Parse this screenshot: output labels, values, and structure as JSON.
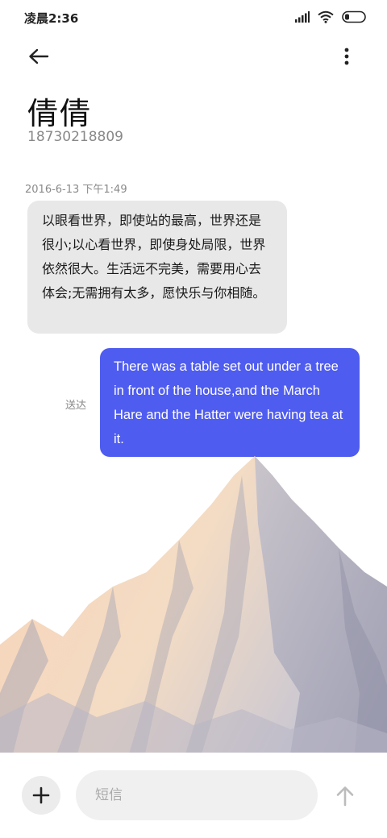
{
  "status_bar": {
    "time": "凌晨2:36"
  },
  "header": {
    "back_icon": "arrow-left-icon",
    "more_icon": "more-vertical-icon"
  },
  "contact": {
    "name": "倩倩",
    "number": "18730218809"
  },
  "messages": [
    {
      "direction": "incoming",
      "timestamp": "2016-6-13 下午1:49",
      "text": "以眼看世界，即使站的最高，世界还是很小;以心看世界，即使身处局限，世界依然很大。生活远不完美，需要用心去体会;无需拥有太多，愿快乐与你相随。"
    },
    {
      "direction": "outgoing",
      "status": "送达",
      "text": "There was a table set out under a tree in front of the house,and the March Hare and the Hatter were having tea at it."
    }
  ],
  "composer": {
    "placeholder": "短信",
    "add_icon": "plus-icon",
    "send_icon": "arrow-up-icon"
  },
  "colors": {
    "outgoing_bubble": "#4f5cf0",
    "incoming_bubble": "#e8e8e8"
  }
}
